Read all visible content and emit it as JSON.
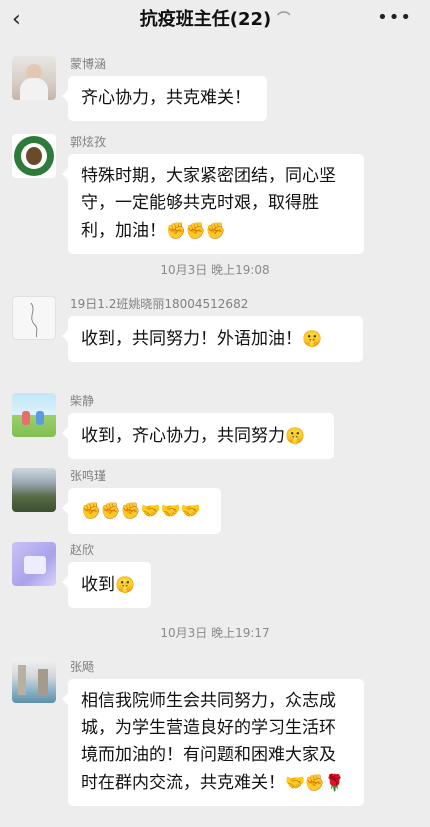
{
  "header": {
    "back_icon": "back-chevron-icon",
    "title": "抗疫班主任(22)",
    "ear_icon": "ear-icon",
    "more_icon": "more-icon"
  },
  "messages": [
    {
      "sender": "蒙博涵",
      "text": "齐心协力，共克难关！",
      "emoji": ""
    },
    {
      "sender": "郭炫孜",
      "text": "特殊时期，大家紧密团结，同心坚守，一定能够共克时艰，取得胜利，加油！",
      "emoji": "✊✊✊"
    },
    {
      "sender": "19日1.2班姚晓丽18004512682",
      "text": "收到，共同努力！外语加油！",
      "emoji": "🤫"
    },
    {
      "sender": "柴静",
      "text": "收到，齐心协力，共同努力",
      "emoji": "🤫"
    },
    {
      "sender": "张鸣瑾",
      "text": "",
      "emoji": "✊✊✊🤝🤝🤝"
    },
    {
      "sender": "赵欣",
      "text": "收到",
      "emoji": "🤫"
    },
    {
      "sender": "张飏",
      "text": "相信我院师生会共同努力，众志成城，为学生营造良好的学习生活环境而加油的！有问题和困难大家及时在群内交流，共克难关！",
      "emoji": "🤝✊🌹"
    }
  ],
  "timestamps": [
    "10月3日 晚上19:08",
    "10月3日 晚上19:17"
  ]
}
